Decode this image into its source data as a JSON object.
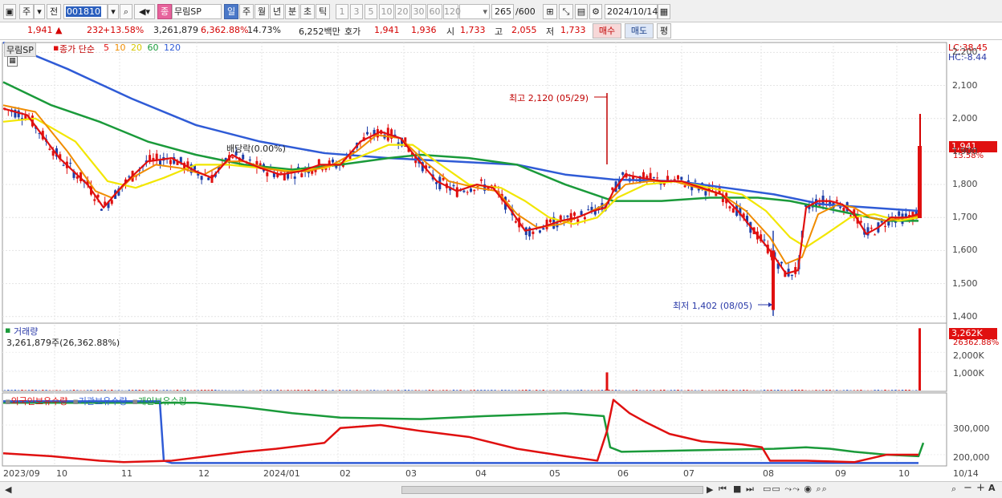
{
  "toolbar": {
    "period_tabs": [
      "주",
      "전"
    ],
    "code": "001810",
    "stock_badge": "종",
    "stock_name": "무림SP",
    "timeframes": [
      {
        "label": "일",
        "selected": true
      },
      {
        "label": "주",
        "selected": false
      },
      {
        "label": "월",
        "selected": false
      },
      {
        "label": "년",
        "selected": false
      },
      {
        "label": "분",
        "selected": false
      },
      {
        "label": "초",
        "selected": false
      },
      {
        "label": "틱",
        "selected": false
      }
    ],
    "intervals": [
      "1",
      "3",
      "5",
      "10",
      "20",
      "30",
      "60",
      "120"
    ],
    "count": "265",
    "count_total": "/600",
    "date": "2024/10/14"
  },
  "quote": {
    "price": "1,941",
    "change": "232",
    "change_pct": "+13.58%",
    "volume": "3,261,879",
    "volume_ratio": "6,362.88%",
    "turnover": "14.73%",
    "amount": "6,252백만",
    "ask_label": "호가",
    "ask": "1,941",
    "bid": "1,936",
    "open_label": "시",
    "open": "1,733",
    "high_label": "고",
    "high": "2,055",
    "low_label": "저",
    "low": "1,733",
    "buy_button": "매수",
    "sell_button": "매도",
    "eval_button": "평"
  },
  "price_panel": {
    "stock_label": "무림SP",
    "ma_title": "종가 단순",
    "ma_periods": [
      {
        "label": "5",
        "color": "#e01010"
      },
      {
        "label": "10",
        "color": "#f08c00"
      },
      {
        "label": "20",
        "color": "#f2e600"
      },
      {
        "label": "60",
        "color": "#1a9a3a"
      },
      {
        "label": "120",
        "color": "#2f5bd6"
      }
    ],
    "lc": "LC:38.45",
    "hc": "HC:-8.44",
    "ytick_labels": [
      "2,200",
      "2,100",
      "2,000",
      "1,900",
      "1,800",
      "1,700",
      "1,600",
      "1,500",
      "1,400"
    ],
    "ytick_values": [
      2200,
      2100,
      2000,
      1900,
      1800,
      1700,
      1600,
      1500,
      1400
    ],
    "high_annotation": "최고 2,120 (05/29)",
    "low_annotation": "최저 1,402 (08/05)",
    "dividend_annotation": "배당락(0.00%)",
    "current_price": "1,941",
    "current_change": "13.58%"
  },
  "volume_panel": {
    "title": "거래량",
    "value": "3,261,879주(26,362.88%)",
    "current_box": "3,262K",
    "current_pct": "26362.88%",
    "ytick_labels": [
      "2,000K",
      "1,000K"
    ]
  },
  "holdings_panel": {
    "legends": [
      {
        "label": "외국인보유수량",
        "color": "#e01010"
      },
      {
        "label": "기관보유수량",
        "color": "#2f5bd6"
      },
      {
        "label": "개인보유수량",
        "color": "#1a9a3a"
      }
    ],
    "ytick_labels": [
      "300,000",
      "200,000"
    ]
  },
  "x_axis": {
    "labels": [
      "2023/09",
      "10",
      "11",
      "12",
      "2024/01",
      "02",
      "03",
      "04",
      "05",
      "06",
      "07",
      "08",
      "09",
      "10",
      "10/14"
    ]
  },
  "chart_data": {
    "type": "candlestick",
    "x_range": [
      "2023/09",
      "2024/10/14"
    ],
    "price_ylim": [
      1380,
      2230
    ],
    "moving_averages": {
      "ma5": [
        [
          0,
          2030
        ],
        [
          30,
          2010
        ],
        [
          70,
          1880
        ],
        [
          105,
          1800
        ],
        [
          125,
          1730
        ],
        [
          150,
          1800
        ],
        [
          180,
          1870
        ],
        [
          210,
          1880
        ],
        [
          240,
          1840
        ],
        [
          260,
          1820
        ],
        [
          285,
          1890
        ],
        [
          300,
          1870
        ],
        [
          320,
          1850
        ],
        [
          345,
          1830
        ],
        [
          370,
          1840
        ],
        [
          395,
          1860
        ],
        [
          420,
          1860
        ],
        [
          445,
          1930
        ],
        [
          470,
          1960
        ],
        [
          495,
          1940
        ],
        [
          515,
          1880
        ],
        [
          540,
          1810
        ],
        [
          565,
          1780
        ],
        [
          590,
          1800
        ],
        [
          610,
          1790
        ],
        [
          630,
          1730
        ],
        [
          650,
          1660
        ],
        [
          670,
          1670
        ],
        [
          695,
          1690
        ],
        [
          715,
          1700
        ],
        [
          735,
          1720
        ],
        [
          750,
          1730
        ],
        [
          760,
          1780
        ],
        [
          775,
          1830
        ],
        [
          795,
          1820
        ],
        [
          820,
          1810
        ],
        [
          845,
          1810
        ],
        [
          870,
          1790
        ],
        [
          895,
          1770
        ],
        [
          915,
          1720
        ],
        [
          935,
          1660
        ],
        [
          955,
          1600
        ],
        [
          975,
          1530
        ],
        [
          990,
          1540
        ],
        [
          1000,
          1730
        ],
        [
          1015,
          1750
        ],
        [
          1030,
          1750
        ],
        [
          1045,
          1740
        ],
        [
          1060,
          1710
        ],
        [
          1075,
          1650
        ],
        [
          1090,
          1670
        ],
        [
          1105,
          1700
        ],
        [
          1125,
          1700
        ],
        [
          1140,
          1710
        ]
      ],
      "ma10": [
        [
          0,
          2040
        ],
        [
          40,
          2020
        ],
        [
          80,
          1900
        ],
        [
          115,
          1780
        ],
        [
          135,
          1760
        ],
        [
          160,
          1820
        ],
        [
          190,
          1860
        ],
        [
          220,
          1850
        ],
        [
          250,
          1830
        ],
        [
          280,
          1870
        ],
        [
          300,
          1870
        ],
        [
          325,
          1850
        ],
        [
          350,
          1840
        ],
        [
          380,
          1840
        ],
        [
          410,
          1860
        ],
        [
          440,
          1900
        ],
        [
          465,
          1950
        ],
        [
          495,
          1940
        ],
        [
          525,
          1870
        ],
        [
          555,
          1810
        ],
        [
          590,
          1790
        ],
        [
          615,
          1780
        ],
        [
          640,
          1710
        ],
        [
          665,
          1670
        ],
        [
          695,
          1680
        ],
        [
          725,
          1710
        ],
        [
          750,
          1740
        ],
        [
          775,
          1800
        ],
        [
          805,
          1810
        ],
        [
          835,
          1810
        ],
        [
          865,
          1790
        ],
        [
          895,
          1770
        ],
        [
          925,
          1720
        ],
        [
          955,
          1640
        ],
        [
          975,
          1560
        ],
        [
          995,
          1580
        ],
        [
          1015,
          1710
        ],
        [
          1040,
          1740
        ],
        [
          1060,
          1730
        ],
        [
          1080,
          1700
        ],
        [
          1100,
          1690
        ],
        [
          1125,
          1700
        ],
        [
          1140,
          1705
        ]
      ],
      "ma20": [
        [
          0,
          1990
        ],
        [
          40,
          2000
        ],
        [
          90,
          1930
        ],
        [
          130,
          1810
        ],
        [
          165,
          1790
        ],
        [
          200,
          1820
        ],
        [
          240,
          1860
        ],
        [
          280,
          1860
        ],
        [
          320,
          1850
        ],
        [
          360,
          1840
        ],
        [
          400,
          1850
        ],
        [
          440,
          1880
        ],
        [
          480,
          1920
        ],
        [
          510,
          1920
        ],
        [
          545,
          1860
        ],
        [
          580,
          1800
        ],
        [
          620,
          1790
        ],
        [
          650,
          1750
        ],
        [
          680,
          1700
        ],
        [
          710,
          1680
        ],
        [
          740,
          1700
        ],
        [
          765,
          1760
        ],
        [
          800,
          1800
        ],
        [
          840,
          1810
        ],
        [
          880,
          1790
        ],
        [
          920,
          1770
        ],
        [
          950,
          1720
        ],
        [
          980,
          1640
        ],
        [
          1000,
          1610
        ],
        [
          1025,
          1650
        ],
        [
          1055,
          1700
        ],
        [
          1085,
          1710
        ],
        [
          1115,
          1690
        ],
        [
          1140,
          1700
        ]
      ],
      "ma60": [
        [
          0,
          2110
        ],
        [
          60,
          2040
        ],
        [
          120,
          1990
        ],
        [
          180,
          1930
        ],
        [
          240,
          1890
        ],
        [
          300,
          1860
        ],
        [
          360,
          1845
        ],
        [
          420,
          1860
        ],
        [
          480,
          1880
        ],
        [
          520,
          1890
        ],
        [
          580,
          1880
        ],
        [
          640,
          1860
        ],
        [
          700,
          1800
        ],
        [
          760,
          1750
        ],
        [
          820,
          1750
        ],
        [
          880,
          1760
        ],
        [
          940,
          1760
        ],
        [
          980,
          1750
        ],
        [
          1040,
          1720
        ],
        [
          1100,
          1690
        ],
        [
          1140,
          1690
        ]
      ],
      "ma120": [
        [
          0,
          2230
        ],
        [
          80,
          2150
        ],
        [
          160,
          2060
        ],
        [
          240,
          1980
        ],
        [
          320,
          1930
        ],
        [
          400,
          1895
        ],
        [
          480,
          1880
        ],
        [
          560,
          1870
        ],
        [
          640,
          1860
        ],
        [
          700,
          1830
        ],
        [
          760,
          1815
        ],
        [
          840,
          1810
        ],
        [
          900,
          1790
        ],
        [
          960,
          1770
        ],
        [
          1020,
          1740
        ],
        [
          1080,
          1730
        ],
        [
          1140,
          1720
        ]
      ]
    },
    "events": [
      {
        "label": "최고 2,120 (05/29)",
        "value": 2120
      },
      {
        "label": "최저 1,402 (08/05)",
        "value": 1402
      }
    ],
    "volume_spikes": [
      {
        "label": "05/29",
        "value": 950
      },
      {
        "label": "10/14",
        "value": 3262
      }
    ],
    "volume_ylim": [
      0,
      3400
    ],
    "holdings": {
      "foreign": [
        [
          0,
          205000
        ],
        [
          60,
          195000
        ],
        [
          120,
          180000
        ],
        [
          150,
          175000
        ],
        [
          210,
          180000
        ],
        [
          300,
          210000
        ],
        [
          340,
          220000
        ],
        [
          400,
          240000
        ],
        [
          420,
          290000
        ],
        [
          470,
          300000
        ],
        [
          520,
          280000
        ],
        [
          580,
          260000
        ],
        [
          640,
          220000
        ],
        [
          700,
          195000
        ],
        [
          740,
          180000
        ],
        [
          752,
          280000
        ],
        [
          760,
          385000
        ],
        [
          780,
          340000
        ],
        [
          800,
          310000
        ],
        [
          830,
          270000
        ],
        [
          870,
          245000
        ],
        [
          920,
          235000
        ],
        [
          945,
          225000
        ],
        [
          955,
          180000
        ],
        [
          1000,
          180000
        ],
        [
          1060,
          175000
        ],
        [
          1100,
          200000
        ],
        [
          1140,
          200000
        ]
      ],
      "institution": [
        [
          0,
          380000
        ],
        [
          195,
          380000
        ],
        [
          200,
          180000
        ],
        [
          210,
          172000
        ],
        [
          1140,
          172000
        ]
      ],
      "individual": [
        [
          0,
          375000
        ],
        [
          240,
          375000
        ],
        [
          300,
          360000
        ],
        [
          360,
          340000
        ],
        [
          420,
          325000
        ],
        [
          520,
          320000
        ],
        [
          600,
          330000
        ],
        [
          700,
          340000
        ],
        [
          748,
          330000
        ],
        [
          756,
          225000
        ],
        [
          770,
          210000
        ],
        [
          860,
          215000
        ],
        [
          960,
          220000
        ],
        [
          1000,
          225000
        ],
        [
          1030,
          220000
        ],
        [
          1060,
          210000
        ],
        [
          1100,
          200000
        ],
        [
          1140,
          195000
        ],
        [
          1146,
          240000
        ]
      ]
    },
    "holdings_ylim": [
      165000,
      400000
    ]
  }
}
